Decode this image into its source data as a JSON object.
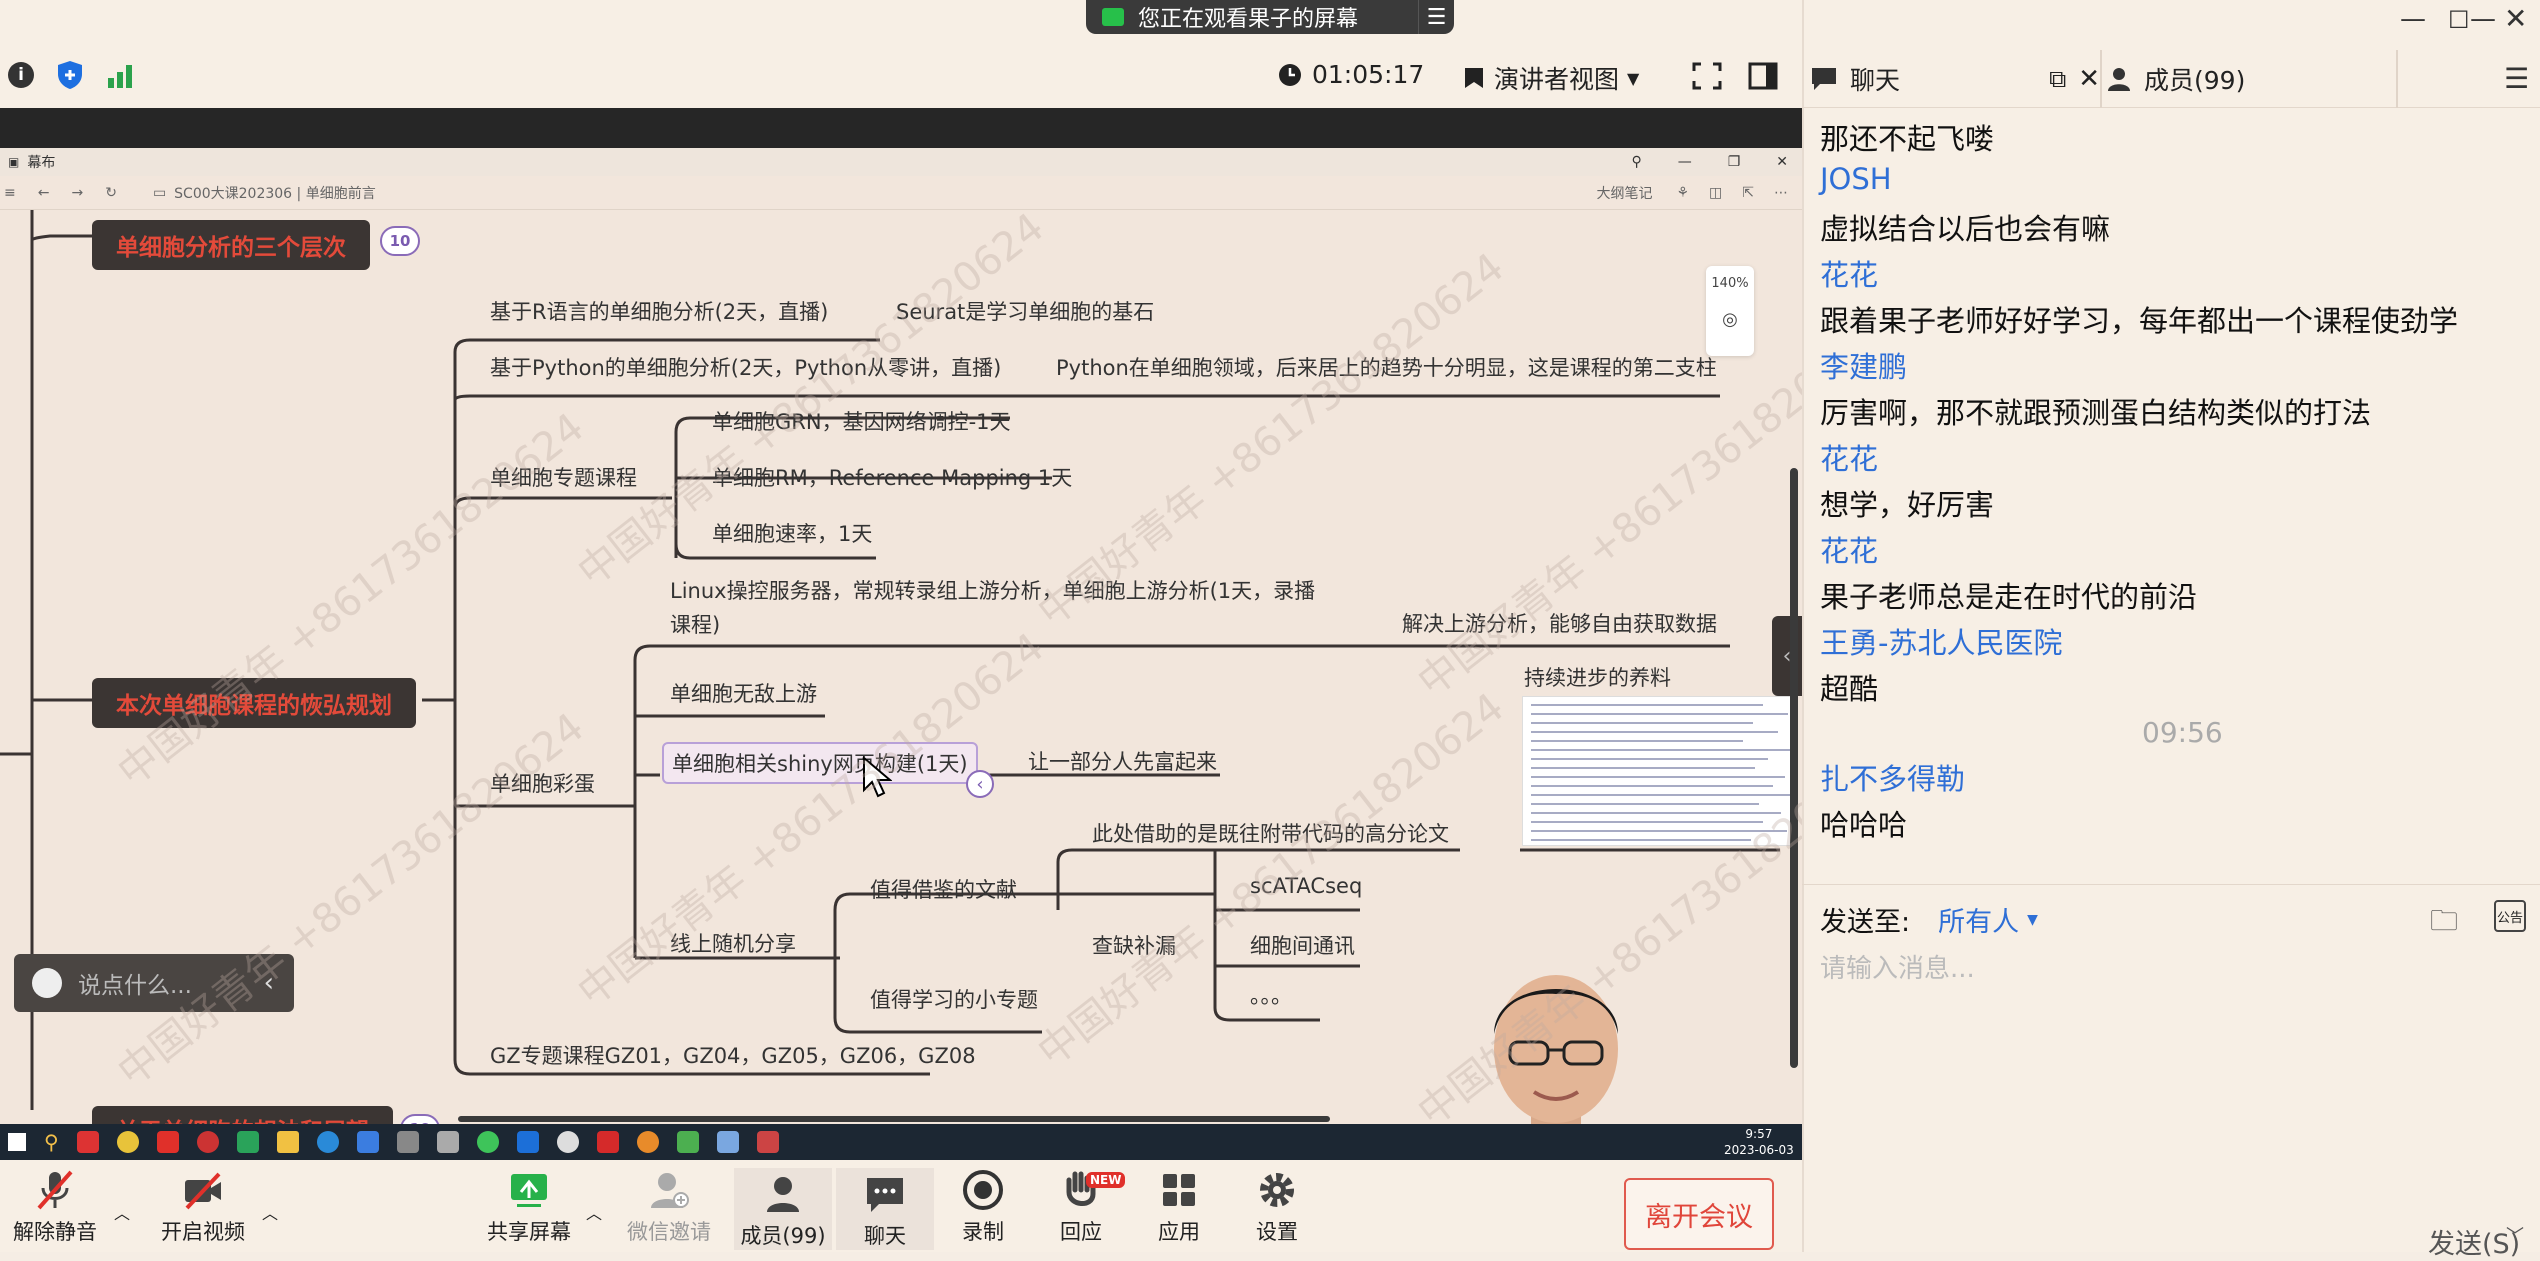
{
  "banner": {
    "text": "您正在观看果子的屏幕"
  },
  "toolbar_top": {
    "timer": "01:05:17",
    "view_label": "演讲者视图"
  },
  "shared_window": {
    "title": "幕布",
    "breadcrumb": "SC00大课202306 | 单细胞前言",
    "outline_note": "大纲笔记",
    "zoom": "140%"
  },
  "mindmap": {
    "node_three_levels": "单细胞分析的三个层次",
    "badge_10": "10",
    "node_plan": "本次单细胞课程的恢弘规划",
    "node_bottom": "关于单细胞的想法和展望",
    "r_course": "基于R语言的单细胞分析(2天，直播)",
    "r_note": "Seurat是学习单细胞的基石",
    "py_course": "基于Python的单细胞分析(2天，Python从零讲，直播)",
    "py_note": "Python在单细胞领域，后来居上的趋势十分明显，这是课程的第二支柱",
    "special": "单细胞专题课程",
    "grn": "单细胞GRN，基因网络调控-1天",
    "rm": "单细胞RM，Reference Mapping 1天",
    "rate": "单细胞速率，1天",
    "linux": "Linux操控服务器，常规转录组上游分析，单细胞上游分析(1天，录播课程)",
    "upstream_note": "解决上游分析，能够自由获取数据",
    "nutrients": "持续进步的养料",
    "easter": "单细胞彩蛋",
    "invincible": "单细胞无敌上游",
    "shiny": "单细胞相关shiny网页构建(1天)",
    "shiny_note": "让一部分人先富起来",
    "borrow_note": "此处借助的是既往附带代码的高分论文",
    "share": "线上随机分享",
    "lit": "值得借鉴的文献",
    "fill": "查缺补漏",
    "topic": "值得学习的小专题",
    "atac": "scATACseq",
    "comm": "细胞间通讯",
    "dots": "。。。",
    "gz": "GZ专题课程GZ01，GZ04，GZ05，GZ06，GZ08"
  },
  "watermark": "中国好青年 +8617361820624",
  "danmaku": {
    "placeholder": "说点什么..."
  },
  "taskbar": {
    "time": "9:57",
    "date": "2023-06-03"
  },
  "bottom_toolbar": {
    "mute": "解除静音",
    "video": "开启视频",
    "share": "共享屏幕",
    "invite": "微信邀请",
    "members": "成员(99)",
    "chat": "聊天",
    "record": "录制",
    "reply": "回应",
    "reply_badge": "NEW",
    "apps": "应用",
    "settings": "设置",
    "leave": "离开会议"
  },
  "panel": {
    "chat_tab": "聊天",
    "members_tab": "成员(99)"
  },
  "chat": [
    {
      "type": "text",
      "text": "那还不起飞喽"
    },
    {
      "type": "name",
      "text": "JOSH"
    },
    {
      "type": "text",
      "text": "虚拟结合以后也会有嘛"
    },
    {
      "type": "name",
      "text": "花花"
    },
    {
      "type": "text",
      "text": "跟着果子老师好好学习，每年都出一个课程使劲学"
    },
    {
      "type": "name",
      "text": "李建鹏"
    },
    {
      "type": "text",
      "text": "厉害啊，那不就跟预测蛋白结构类似的打法"
    },
    {
      "type": "name",
      "text": "花花"
    },
    {
      "type": "text",
      "text": "想学，好厉害"
    },
    {
      "type": "name",
      "text": "花花"
    },
    {
      "type": "text",
      "text": "果子老师总是走在时代的前沿"
    },
    {
      "type": "name",
      "text": "王勇-苏北人民医院"
    },
    {
      "type": "text",
      "text": "超酷"
    },
    {
      "type": "time",
      "text": "09:56"
    },
    {
      "type": "name",
      "text": "扎不多得勒"
    },
    {
      "type": "text",
      "text": "哈哈哈"
    }
  ],
  "send": {
    "label": "发送至:",
    "target": "所有人",
    "placeholder": "请输入消息...",
    "button": "发送(S)",
    "notice": "公告"
  },
  "colors": {
    "accent_blue": "#2f6fd6",
    "leave_red": "#e0453a",
    "mind_red": "#e34a3a"
  }
}
